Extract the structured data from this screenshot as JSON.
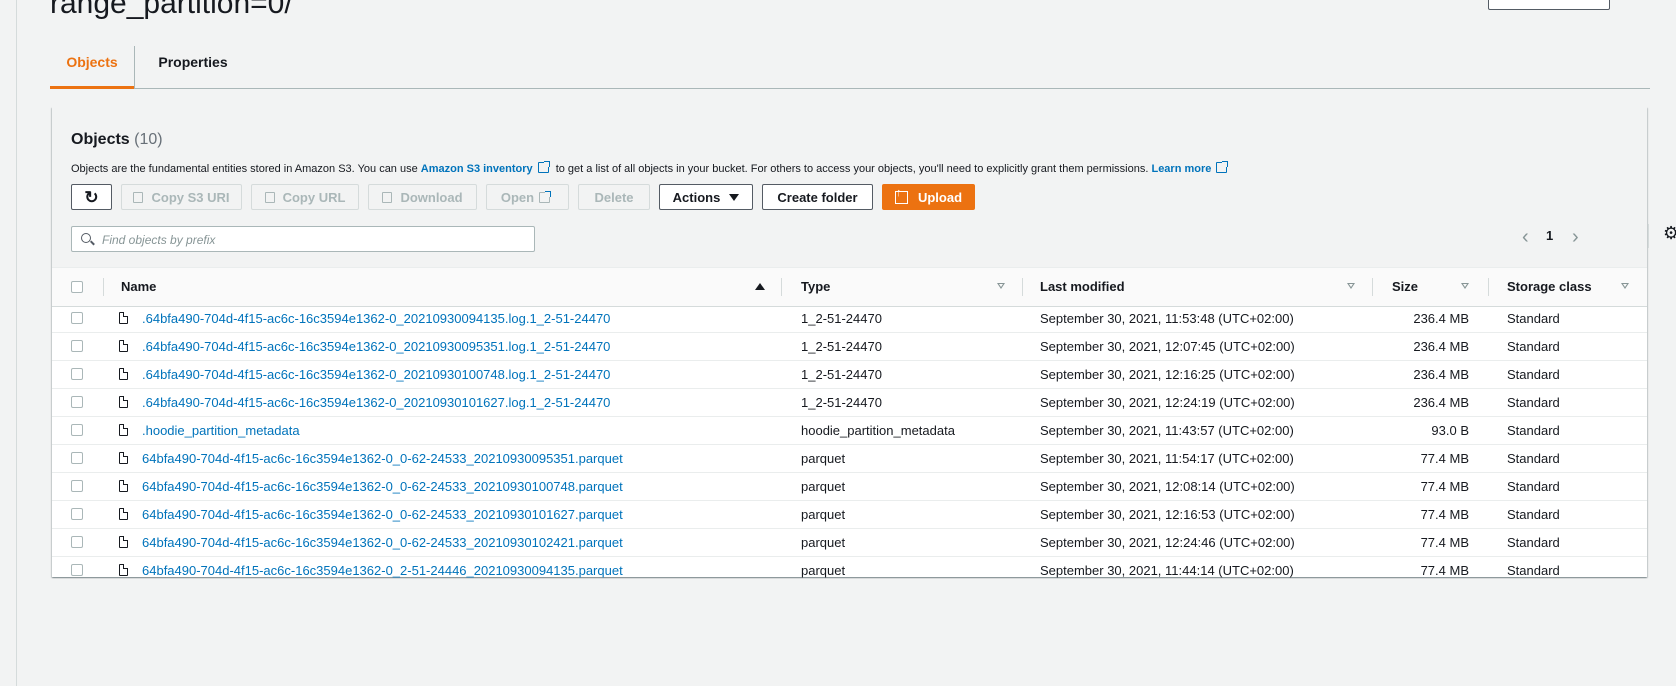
{
  "page": {
    "title": "range_partition=0/"
  },
  "tabs": [
    {
      "label": "Objects",
      "active": true
    },
    {
      "label": "Properties",
      "active": false
    }
  ],
  "objects_panel": {
    "title": "Objects",
    "count": "(10)",
    "description": {
      "before": "Objects are the fundamental entities stored in Amazon S3. You can use ",
      "inventory_link": "Amazon S3 inventory",
      "middle": " to get a list of all objects in your bucket. For others to access your objects, you'll need to explicitly grant them permissions. ",
      "learn_more": "Learn more"
    },
    "toolbar": {
      "copy_s3_uri": "Copy S3 URI",
      "copy_url": "Copy URL",
      "download": "Download",
      "open": "Open",
      "delete": "Delete",
      "actions": "Actions",
      "create_folder": "Create folder",
      "upload": "Upload"
    },
    "search": {
      "placeholder": "Find objects by prefix",
      "value": ""
    },
    "pagination": {
      "current_page": "1"
    }
  },
  "table": {
    "columns": {
      "name": "Name",
      "type": "Type",
      "last_modified": "Last modified",
      "size": "Size",
      "storage_class": "Storage class"
    },
    "rows": [
      {
        "name": ".64bfa490-704d-4f15-ac6c-16c3594e1362-0_20210930094135.log.1_2-51-24470",
        "type": "1_2-51-24470",
        "last_modified": "September 30, 2021, 11:53:48 (UTC+02:00)",
        "size": "236.4 MB",
        "storage_class": "Standard"
      },
      {
        "name": ".64bfa490-704d-4f15-ac6c-16c3594e1362-0_20210930095351.log.1_2-51-24470",
        "type": "1_2-51-24470",
        "last_modified": "September 30, 2021, 12:07:45 (UTC+02:00)",
        "size": "236.4 MB",
        "storage_class": "Standard"
      },
      {
        "name": ".64bfa490-704d-4f15-ac6c-16c3594e1362-0_20210930100748.log.1_2-51-24470",
        "type": "1_2-51-24470",
        "last_modified": "September 30, 2021, 12:16:25 (UTC+02:00)",
        "size": "236.4 MB",
        "storage_class": "Standard"
      },
      {
        "name": ".64bfa490-704d-4f15-ac6c-16c3594e1362-0_20210930101627.log.1_2-51-24470",
        "type": "1_2-51-24470",
        "last_modified": "September 30, 2021, 12:24:19 (UTC+02:00)",
        "size": "236.4 MB",
        "storage_class": "Standard"
      },
      {
        "name": ".hoodie_partition_metadata",
        "type": "hoodie_partition_metadata",
        "last_modified": "September 30, 2021, 11:43:57 (UTC+02:00)",
        "size": "93.0 B",
        "storage_class": "Standard"
      },
      {
        "name": "64bfa490-704d-4f15-ac6c-16c3594e1362-0_0-62-24533_20210930095351.parquet",
        "type": "parquet",
        "last_modified": "September 30, 2021, 11:54:17 (UTC+02:00)",
        "size": "77.4 MB",
        "storage_class": "Standard"
      },
      {
        "name": "64bfa490-704d-4f15-ac6c-16c3594e1362-0_0-62-24533_20210930100748.parquet",
        "type": "parquet",
        "last_modified": "September 30, 2021, 12:08:14 (UTC+02:00)",
        "size": "77.4 MB",
        "storage_class": "Standard"
      },
      {
        "name": "64bfa490-704d-4f15-ac6c-16c3594e1362-0_0-62-24533_20210930101627.parquet",
        "type": "parquet",
        "last_modified": "September 30, 2021, 12:16:53 (UTC+02:00)",
        "size": "77.4 MB",
        "storage_class": "Standard"
      },
      {
        "name": "64bfa490-704d-4f15-ac6c-16c3594e1362-0_0-62-24533_20210930102421.parquet",
        "type": "parquet",
        "last_modified": "September 30, 2021, 12:24:46 (UTC+02:00)",
        "size": "77.4 MB",
        "storage_class": "Standard"
      },
      {
        "name": "64bfa490-704d-4f15-ac6c-16c3594e1362-0_2-51-24446_20210930094135.parquet",
        "type": "parquet",
        "last_modified": "September 30, 2021, 11:44:14 (UTC+02:00)",
        "size": "77.4 MB",
        "storage_class": "Standard"
      }
    ]
  },
  "colors": {
    "accent": "#ec7211",
    "link": "#0073bb",
    "background": "#f2f3f3"
  },
  "icons": [
    "refresh-icon",
    "copy-icon",
    "download-icon",
    "external-link-icon",
    "caret-down-icon",
    "upload-icon",
    "search-icon",
    "chevron-left-icon",
    "chevron-right-icon",
    "gear-icon",
    "file-icon",
    "sort-ascending-icon",
    "sort-icon"
  ]
}
